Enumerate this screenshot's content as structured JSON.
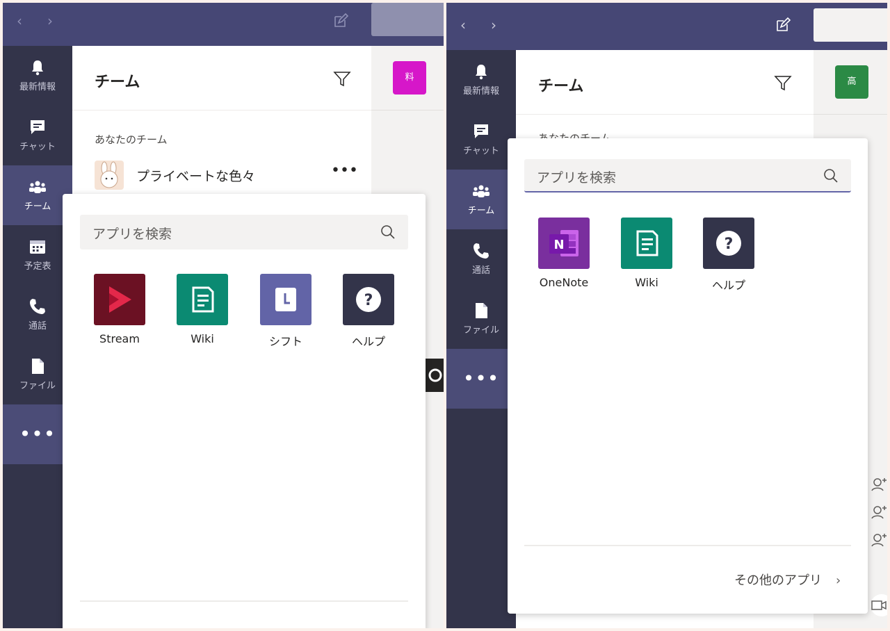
{
  "nav": {
    "back": "‹",
    "forward": "›"
  },
  "rail": {
    "activity": "最新情報",
    "chat": "チャット",
    "teams": "チーム",
    "calendar": "予定表",
    "calls": "通話",
    "files": "ファイル",
    "more": "•••"
  },
  "left": {
    "teams_panel": {
      "title": "チーム",
      "section_label": "あなたのチーム",
      "team_name": "プライベートな色々",
      "more": "•••"
    },
    "chip_text": "料",
    "chip_color": "#d617c9",
    "popup": {
      "search_placeholder": "アプリを検索",
      "apps": [
        {
          "name": "Stream",
          "icon": "stream-icon",
          "color": "#6b1123"
        },
        {
          "name": "Wiki",
          "icon": "wiki-icon",
          "color": "#0b8a72"
        },
        {
          "name": "シフト",
          "icon": "shifts-icon",
          "color": "#6264a7"
        },
        {
          "name": "ヘルプ",
          "icon": "help-icon",
          "color": "#33344a"
        }
      ]
    }
  },
  "right": {
    "teams_panel": {
      "title": "チーム",
      "section_label": "あなたのチーム"
    },
    "chip_text": "高",
    "chip_color": "#2b8a45",
    "popup": {
      "search_placeholder": "アプリを検索",
      "apps": [
        {
          "name": "OneNote",
          "icon": "onenote-icon",
          "color": "#7a2f9e"
        },
        {
          "name": "Wiki",
          "icon": "wiki-icon",
          "color": "#0b8a72"
        },
        {
          "name": "ヘルプ",
          "icon": "help-icon",
          "color": "#33344a"
        }
      ],
      "more_apps": "その他のアプリ",
      "more_apps_chevron": "›"
    }
  },
  "colors": {
    "topbar": "#464775",
    "rail": "#33344a",
    "rail_active": "#4b4c77"
  }
}
